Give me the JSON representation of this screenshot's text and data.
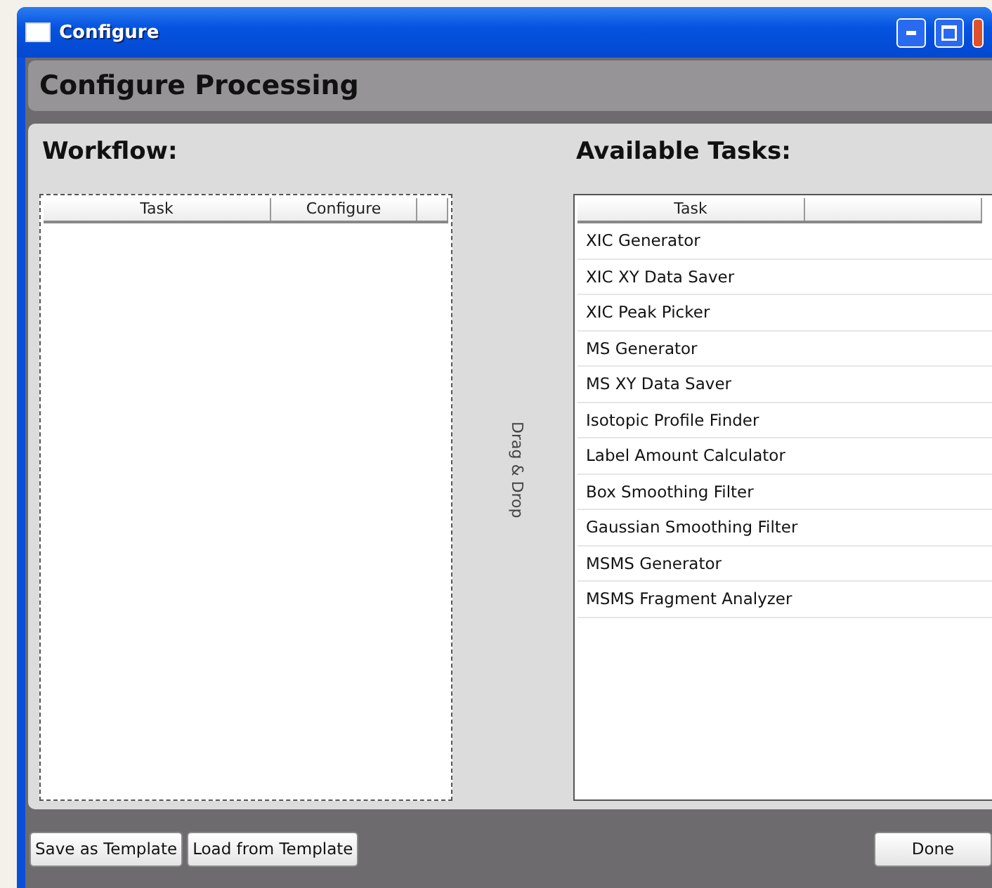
{
  "window": {
    "title": "Configure"
  },
  "header": "Configure Processing",
  "workflow": {
    "label": "Workflow:",
    "columns": [
      "Task",
      "Configure"
    ]
  },
  "drag_hint": "Drag & Drop",
  "available": {
    "label": "Available Tasks:",
    "columns": [
      "Task"
    ],
    "rows": [
      "XIC Generator",
      "XIC XY Data Saver",
      "XIC Peak Picker",
      "MS Generator",
      "MS XY Data Saver",
      "Isotopic Profile Finder",
      "Label Amount Calculator",
      "Box Smoothing Filter",
      "Gaussian Smoothing Filter",
      "MSMS Generator",
      "MSMS Fragment Analyzer"
    ]
  },
  "buttons": {
    "left": [
      "Save as Template",
      "Load from Template"
    ],
    "right": [
      "Done"
    ]
  }
}
